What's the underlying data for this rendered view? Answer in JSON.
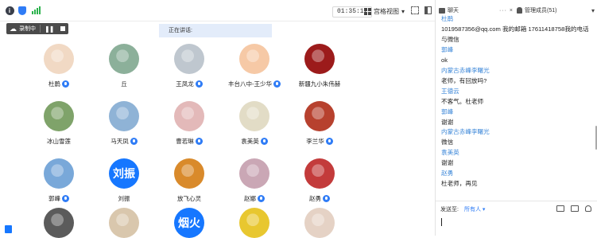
{
  "toolbar": {
    "info_glyph": "i",
    "timer": "01:35:12",
    "view_mode": "宫格视图",
    "view_caret": "▾",
    "icons": [
      "info-icon",
      "shield-icon",
      "signal-icon",
      "grid-icon",
      "fullscreen-icon",
      "split-view-icon"
    ]
  },
  "recording": {
    "label": "录制中",
    "cloud_glyph": "☁",
    "pause_glyph": "❚❚"
  },
  "speaking_banner": "正在讲话:",
  "gallery": {
    "tiles": [
      {
        "name": "杜鹃",
        "mic": true,
        "avatar": "photo",
        "color": "#f1d9c4"
      },
      {
        "name": "丘",
        "mic": false,
        "avatar": "photo",
        "color": "#8cb09a"
      },
      {
        "name": "王凤龙",
        "mic": true,
        "avatar": "photo",
        "color": "#bfc7cf"
      },
      {
        "name": "丰台八中-王少华",
        "mic": true,
        "avatar": "photo",
        "color": "#f6c9a6"
      },
      {
        "name": "新疆九小朱伟赫",
        "mic": false,
        "avatar": "photo",
        "color": "#9c1b1b"
      },
      {
        "name": "冰山雪莲",
        "mic": false,
        "avatar": "photo",
        "color": "#7fa36a"
      },
      {
        "name": "马天凤",
        "mic": true,
        "avatar": "photo",
        "color": "#8fb3d6"
      },
      {
        "name": "曹若琳",
        "mic": true,
        "avatar": "photo",
        "color": "#e3b9b9"
      },
      {
        "name": "袁美英",
        "mic": true,
        "avatar": "photo",
        "color": "#e2dcc6"
      },
      {
        "name": "李兰华",
        "mic": true,
        "avatar": "photo",
        "color": "#b7412e"
      },
      {
        "name": "郭峰",
        "mic": true,
        "avatar": "photo",
        "color": "#79a8d9"
      },
      {
        "name": "刘振",
        "mic": false,
        "avatar": "text",
        "avatar_text": "刘振",
        "color": "#1677ff"
      },
      {
        "name": "放飞心灵",
        "mic": false,
        "avatar": "photo",
        "color": "#d98a2b"
      },
      {
        "name": "赵娜",
        "mic": true,
        "avatar": "photo",
        "color": "#caa7b5"
      },
      {
        "name": "赵勇",
        "mic": true,
        "avatar": "photo",
        "color": "#c33b3b"
      },
      {
        "name": "",
        "mic": false,
        "avatar": "photo",
        "color": "#5b5b5b"
      },
      {
        "name": "",
        "mic": false,
        "avatar": "photo",
        "color": "#d9c7ad"
      },
      {
        "name": "",
        "mic": false,
        "avatar": "text",
        "avatar_text": "烟火",
        "color": "#1677ff"
      },
      {
        "name": "",
        "mic": false,
        "avatar": "photo",
        "color": "#e8c730"
      },
      {
        "name": "",
        "mic": false,
        "avatar": "photo",
        "color": "#e5d2c5"
      }
    ]
  },
  "panel": {
    "chat_tab": "聊天",
    "chat_tab_controls": "··· ×",
    "members_tab": "管理成员(51)",
    "close": "▾",
    "messages": [
      {
        "kind": "name",
        "text": "杜鹃"
      },
      {
        "kind": "text",
        "text": "1019587356@qq.com 我的邮箱 17611418758我的电话"
      },
      {
        "kind": "text",
        "text": "与微信"
      },
      {
        "kind": "name",
        "text": "郭峰"
      },
      {
        "kind": "text",
        "text": "ok"
      },
      {
        "kind": "name",
        "text": "内蒙古赤峰李曙光"
      },
      {
        "kind": "text",
        "text": "老师，有回放吗?"
      },
      {
        "kind": "name",
        "text": "王德云"
      },
      {
        "kind": "text",
        "text": "不客气。杜老师"
      },
      {
        "kind": "name",
        "text": "郭峰"
      },
      {
        "kind": "text",
        "text": "谢谢"
      },
      {
        "kind": "name",
        "text": "内蒙古赤峰李曙光"
      },
      {
        "kind": "text",
        "text": "微信"
      },
      {
        "kind": "name",
        "text": "袁美英"
      },
      {
        "kind": "text",
        "text": "谢谢"
      },
      {
        "kind": "name",
        "text": "赵勇"
      },
      {
        "kind": "text",
        "text": "杜老师，再见"
      }
    ],
    "send_to_label": "发送至:",
    "send_to_target": "所有人 ▾",
    "input_icons": [
      "file-icon",
      "image-icon",
      "person-icon"
    ]
  }
}
